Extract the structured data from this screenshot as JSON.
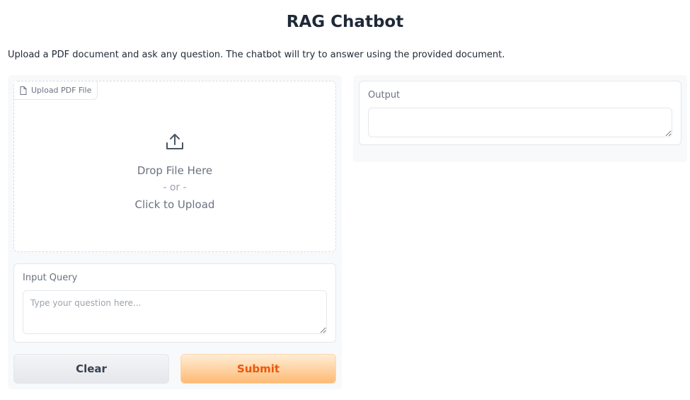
{
  "header": {
    "title": "RAG Chatbot",
    "description": "Upload a PDF document and ask any question. The chatbot will try to answer using the provided document."
  },
  "upload": {
    "tab_label": "Upload PDF File",
    "drop_text": "Drop File Here",
    "or_text": "- or -",
    "click_text": "Click to Upload",
    "icon": "upload-icon",
    "tab_icon": "file-icon"
  },
  "query": {
    "label": "Input Query",
    "placeholder": "Type your question here...",
    "value": ""
  },
  "output": {
    "label": "Output",
    "value": ""
  },
  "buttons": {
    "clear_label": "Clear",
    "submit_label": "Submit"
  },
  "colors": {
    "accent": "#ea580c",
    "submit_bg": "#fdba74",
    "clear_bg": "#e5e7eb"
  }
}
